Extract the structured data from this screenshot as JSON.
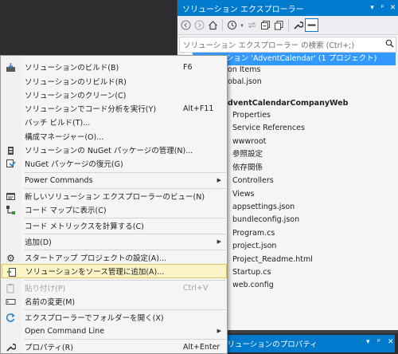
{
  "solution_explorer": {
    "title": "ソリューション エクスプローラー",
    "title_controls": [
      "▾",
      "ᵖ",
      "✕"
    ],
    "toolbar_icons": [
      "back-icon",
      "forward-icon",
      "home-icon",
      "history-icon",
      "sync-icon",
      "collapse-icon",
      "copy-icon",
      "wrench-icon",
      "pin-icon"
    ],
    "search_placeholder": "ソリューション エクスプローラー の検索 (Ctrl+;)",
    "tree": [
      {
        "text": "ソリューション 'AdventCalendar' (1 プロジェクト)",
        "selected": true
      },
      {
        "text": "on Items"
      },
      {
        "text": "obal.json"
      },
      {
        "text": "dventCalendarCompanyWeb",
        "bold": true
      },
      {
        "text": "Properties"
      },
      {
        "text": "Service References"
      },
      {
        "text": "wwwroot"
      },
      {
        "text": "参照設定"
      },
      {
        "text": "依存関係"
      },
      {
        "text": "Controllers"
      },
      {
        "text": "Views"
      },
      {
        "text": "appsettings.json"
      },
      {
        "text": "bundleconfig.json"
      },
      {
        "text": "Program.cs"
      },
      {
        "text": "project.json"
      },
      {
        "text": "Project_Readme.html"
      },
      {
        "text": "Startup.cs"
      },
      {
        "text": "web.config"
      }
    ]
  },
  "bottom_tab": {
    "label": "ソリューションのプロパティ",
    "controls": [
      "▾",
      "ᵖ",
      "✕"
    ]
  },
  "colors": {
    "accent": "#007acc",
    "selection": "#3399ff",
    "highlight": "#fcf3c6"
  },
  "context_menu": {
    "items": [
      {
        "label": "ソリューションのビルド(B)",
        "shortcut": "F6",
        "icon": "build-icon"
      },
      {
        "label": "ソリューションのリビルド(R)",
        "shortcut": ""
      },
      {
        "label": "ソリューションのクリーン(C)",
        "shortcut": ""
      },
      {
        "label": "ソリューションでコード分析を実行(Y)",
        "shortcut": "Alt+F11"
      },
      {
        "label": "バッチ ビルド(T)...",
        "shortcut": ""
      },
      {
        "label": "構成マネージャー(O)...",
        "shortcut": ""
      },
      {
        "label": "ソリューションの NuGet パッケージの管理(N)...",
        "shortcut": "",
        "icon": "nuget-icon"
      },
      {
        "label": "NuGet パッケージの復元(G)",
        "shortcut": "",
        "icon": "restore-icon"
      },
      {
        "label": "Power Commands",
        "shortcut": "",
        "submenu": true
      },
      {
        "label": "新しいソリューション エクスプローラーのビュー(N)",
        "shortcut": "",
        "icon": "new-view-icon"
      },
      {
        "label": "コード マップに表示(C)",
        "shortcut": "",
        "icon": "code-map-icon"
      },
      {
        "label": "コード メトリックスを計算する(C)",
        "shortcut": ""
      },
      {
        "label": "追加(D)",
        "shortcut": "",
        "submenu": true
      },
      {
        "label": "スタートアップ プロジェクトの設定(A)...",
        "shortcut": "",
        "icon": "gear-icon"
      },
      {
        "label": "ソリューションをソース管理に追加(A)...",
        "shortcut": "",
        "icon": "source-control-icon",
        "highlighted": true
      },
      {
        "label": "貼り付け(P)",
        "shortcut": "Ctrl+V",
        "icon": "paste-icon",
        "disabled": true
      },
      {
        "label": "名前の変更(M)",
        "shortcut": "",
        "icon": "rename-icon"
      },
      {
        "label": "エクスプローラーでフォルダーを開く(X)",
        "shortcut": "",
        "icon": "refresh-folder-icon"
      },
      {
        "label": "Open Command Line",
        "shortcut": "",
        "submenu": true
      },
      {
        "label": "プロパティ(R)",
        "shortcut": "Alt+Enter",
        "icon": "wrench-icon"
      }
    ]
  }
}
